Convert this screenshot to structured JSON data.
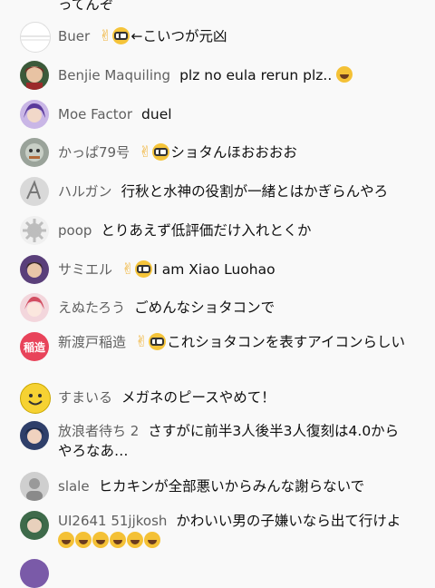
{
  "chat": {
    "partial_top_text": "ってんぞ",
    "messages": [
      {
        "author": "Buer",
        "text": "←こいつが元凶"
      },
      {
        "author": "Benjie Maquiling",
        "text": "plz no eula rerun plz.."
      },
      {
        "author": "Moe Factor",
        "text": "duel"
      },
      {
        "author": "かっぱ79号",
        "text": "ショタんほおおおお"
      },
      {
        "author": "ハルガン",
        "text": "行秋と水神の役割が一緒とはかぎらんやろ"
      },
      {
        "author": "poop",
        "text": "とりあえず低評価だけ入れとくか"
      },
      {
        "author": "サミエル",
        "text": "I am Xiao Luohao"
      },
      {
        "author": "えぬたろう",
        "text": "ごめんなショタコンで"
      },
      {
        "author": "新渡戸稲造",
        "text": "これショタコンを表すアイコンらしい",
        "avatar_text": "稲造"
      },
      {
        "author": "すまいる",
        "text": "メガネのピースやめて！"
      },
      {
        "author": "放浪者待ち 2",
        "text": "さすがに前半3人後半3人復刻は4.0からやろなあ…"
      },
      {
        "author": "slale",
        "text": "ヒカキンが全部悪いからみんな謝らないで"
      },
      {
        "author": "UI2641 51jjkosh",
        "text": "かわいい男の子嫌いなら出て行けよ"
      }
    ]
  },
  "colors": {
    "background": "#f9f9f9",
    "author": "#606060",
    "message": "#0f0f0f",
    "avatar_red": "#e8435a"
  }
}
